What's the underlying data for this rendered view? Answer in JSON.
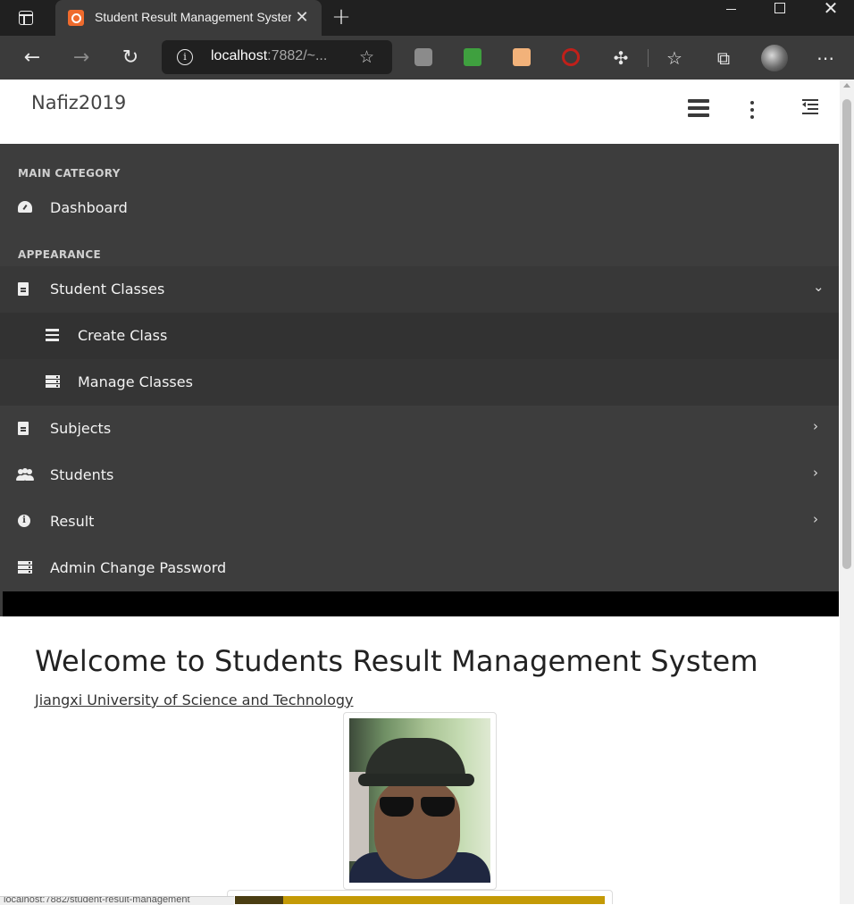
{
  "browser": {
    "tab_title": "Student Result Management System",
    "tab_close": "✕",
    "new_tab": "+",
    "address_host": "localhost",
    "address_rest": ":7882/~...",
    "status_url": "localhost:7882/student-result-management"
  },
  "header": {
    "brand": "Nafiz2019"
  },
  "sidebar": {
    "categories": [
      "MAIN CATEGORY",
      "APPEARANCE"
    ],
    "items": [
      {
        "label": "Dashboard",
        "icon": "dashboard-icon"
      },
      {
        "label": "Student Classes",
        "icon": "file-icon",
        "expanded": true
      },
      {
        "label": "Create Class",
        "icon": "bars-icon"
      },
      {
        "label": "Manage Classes",
        "icon": "server-icon"
      },
      {
        "label": "Subjects",
        "icon": "file-icon"
      },
      {
        "label": "Students",
        "icon": "users-icon"
      },
      {
        "label": "Result",
        "icon": "info-icon"
      },
      {
        "label": "Admin Change Password",
        "icon": "server-icon"
      }
    ]
  },
  "main": {
    "welcome": "Welcome to Students Result Management System",
    "university": "Jiangxi University of Science and Technology"
  },
  "colors": {
    "sidebar_bg": "#3d3d3d",
    "browser_dark": "#202020",
    "tab_favicon": "#ef6b2d"
  }
}
